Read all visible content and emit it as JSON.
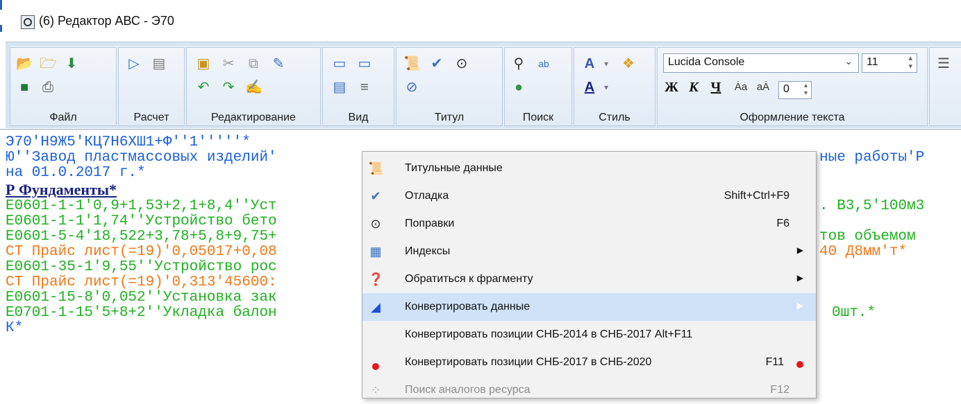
{
  "window": {
    "title": "(6) Редактор АВС - Э70"
  },
  "ribbon": {
    "groups": [
      {
        "label": "Файл"
      },
      {
        "label": "Расчет"
      },
      {
        "label": "Редактирование"
      },
      {
        "label": "Вид"
      },
      {
        "label": "Титул"
      },
      {
        "label": "Поиск"
      },
      {
        "label": "Стиль"
      },
      {
        "label": "Оформление текста"
      }
    ],
    "font_name": "Lucida Console",
    "font_size": "11",
    "spacing_value": "0",
    "style_buttons": [
      "Ж",
      "К",
      "Ч"
    ]
  },
  "editor": {
    "lines": [
      {
        "text": "Э70'Н9Ж5'КЦ7Н6ХШ1+Ф''1'''''*",
        "color": "blue"
      },
      {
        "text": "Ю''Завод пластмассовых изделий'",
        "tail": "ные работы'Р",
        "color": "blue"
      },
      {
        "text": "на 01.0.2017 г.*",
        "color": "blue"
      },
      {
        "text": "Р Фундаменты*",
        "color": "head"
      },
      {
        "text": "Е0601-1-1'0,9+1,53+2,1+8,4''Уст",
        "tail": ". В3,5'100м3",
        "color": "green"
      },
      {
        "text": "Е0601-1-1'1,74''Устройство бето",
        "tail": "",
        "color": "green"
      },
      {
        "text": "Е0601-5-4'18,522+3,78+5,8+9,75+",
        "tail": "тов объемом",
        "color": "green"
      },
      {
        "text": "СТ Прайс лист(=19)'0,05017+0,08",
        "tail": "40 Д8мм'т*",
        "color": "orange"
      },
      {
        "text": "Е0601-35-1'9,55''Устройство рос",
        "tail": "",
        "color": "green"
      },
      {
        "text": "СТ Прайс лист(=19)'0,313'45600:",
        "tail": "",
        "color": "orange"
      },
      {
        "text": "Е0601-15-8'0,052''Установка зак",
        "tail": "",
        "color": "green"
      },
      {
        "text": "Е0701-1-15'5+8+2''Укладка балон",
        "tail": "0шт.*",
        "color": "green"
      },
      {
        "text": "К*",
        "color": "blue"
      }
    ]
  },
  "context_menu": {
    "items": [
      {
        "label": "Титульные данные",
        "shortcut": "",
        "icon": "title-data-icon",
        "submenu": false
      },
      {
        "label": "Отладка",
        "shortcut": "Shift+Ctrl+F9",
        "icon": "spellcheck-icon",
        "submenu": false
      },
      {
        "label": "Поправки",
        "shortcut": "F6",
        "icon": "corrections-icon",
        "submenu": false
      },
      {
        "label": "Индексы",
        "shortcut": "",
        "icon": "indexes-icon",
        "submenu": true
      },
      {
        "label": "Обратиться к фрагменту",
        "shortcut": "",
        "icon": "help-circle-icon",
        "submenu": true
      },
      {
        "label": "Конвертировать данные",
        "shortcut": "",
        "icon": "convert-icon",
        "submenu": true,
        "selected": true
      },
      {
        "label": "Конвертировать позиции СНБ-2014 в СНБ-2017 Alt+F11",
        "shortcut": "",
        "icon": "",
        "submenu": false
      },
      {
        "label": "Конвертировать позиции СНБ-2017 в СНБ-2020",
        "shortcut": "F11",
        "icon": "red-dot-icon",
        "submenu": false
      },
      {
        "label": "Поиск аналогов ресурса",
        "shortcut": "F12",
        "icon": "resource-search-icon",
        "submenu": false,
        "disabled": true
      }
    ]
  },
  "colors": {
    "editor_blue": "#1a5fe0",
    "editor_green": "#20b020",
    "editor_orange": "#f07818",
    "menu_selected": "#cfe2f8",
    "red_dot": "#e8141c"
  }
}
